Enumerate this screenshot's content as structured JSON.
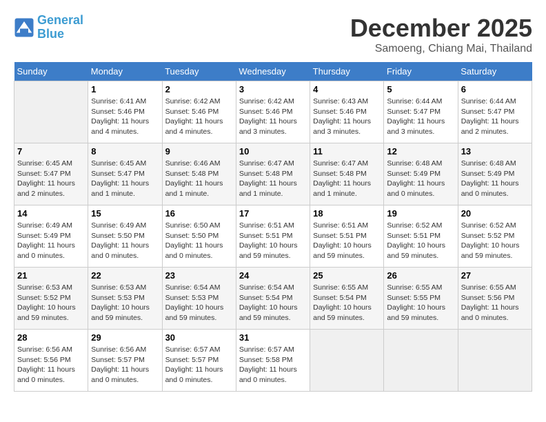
{
  "header": {
    "logo_line1": "General",
    "logo_line2": "Blue",
    "month": "December 2025",
    "location": "Samoeng, Chiang Mai, Thailand"
  },
  "days_of_week": [
    "Sunday",
    "Monday",
    "Tuesday",
    "Wednesday",
    "Thursday",
    "Friday",
    "Saturday"
  ],
  "weeks": [
    [
      {
        "day": "",
        "empty": true
      },
      {
        "day": "1",
        "sunrise": "Sunrise: 6:41 AM",
        "sunset": "Sunset: 5:46 PM",
        "daylight": "Daylight: 11 hours and 4 minutes."
      },
      {
        "day": "2",
        "sunrise": "Sunrise: 6:42 AM",
        "sunset": "Sunset: 5:46 PM",
        "daylight": "Daylight: 11 hours and 4 minutes."
      },
      {
        "day": "3",
        "sunrise": "Sunrise: 6:42 AM",
        "sunset": "Sunset: 5:46 PM",
        "daylight": "Daylight: 11 hours and 3 minutes."
      },
      {
        "day": "4",
        "sunrise": "Sunrise: 6:43 AM",
        "sunset": "Sunset: 5:46 PM",
        "daylight": "Daylight: 11 hours and 3 minutes."
      },
      {
        "day": "5",
        "sunrise": "Sunrise: 6:44 AM",
        "sunset": "Sunset: 5:47 PM",
        "daylight": "Daylight: 11 hours and 3 minutes."
      },
      {
        "day": "6",
        "sunrise": "Sunrise: 6:44 AM",
        "sunset": "Sunset: 5:47 PM",
        "daylight": "Daylight: 11 hours and 2 minutes."
      }
    ],
    [
      {
        "day": "7",
        "sunrise": "Sunrise: 6:45 AM",
        "sunset": "Sunset: 5:47 PM",
        "daylight": "Daylight: 11 hours and 2 minutes."
      },
      {
        "day": "8",
        "sunrise": "Sunrise: 6:45 AM",
        "sunset": "Sunset: 5:47 PM",
        "daylight": "Daylight: 11 hours and 1 minute."
      },
      {
        "day": "9",
        "sunrise": "Sunrise: 6:46 AM",
        "sunset": "Sunset: 5:48 PM",
        "daylight": "Daylight: 11 hours and 1 minute."
      },
      {
        "day": "10",
        "sunrise": "Sunrise: 6:47 AM",
        "sunset": "Sunset: 5:48 PM",
        "daylight": "Daylight: 11 hours and 1 minute."
      },
      {
        "day": "11",
        "sunrise": "Sunrise: 6:47 AM",
        "sunset": "Sunset: 5:48 PM",
        "daylight": "Daylight: 11 hours and 1 minute."
      },
      {
        "day": "12",
        "sunrise": "Sunrise: 6:48 AM",
        "sunset": "Sunset: 5:49 PM",
        "daylight": "Daylight: 11 hours and 0 minutes."
      },
      {
        "day": "13",
        "sunrise": "Sunrise: 6:48 AM",
        "sunset": "Sunset: 5:49 PM",
        "daylight": "Daylight: 11 hours and 0 minutes."
      }
    ],
    [
      {
        "day": "14",
        "sunrise": "Sunrise: 6:49 AM",
        "sunset": "Sunset: 5:49 PM",
        "daylight": "Daylight: 11 hours and 0 minutes."
      },
      {
        "day": "15",
        "sunrise": "Sunrise: 6:49 AM",
        "sunset": "Sunset: 5:50 PM",
        "daylight": "Daylight: 11 hours and 0 minutes."
      },
      {
        "day": "16",
        "sunrise": "Sunrise: 6:50 AM",
        "sunset": "Sunset: 5:50 PM",
        "daylight": "Daylight: 11 hours and 0 minutes."
      },
      {
        "day": "17",
        "sunrise": "Sunrise: 6:51 AM",
        "sunset": "Sunset: 5:51 PM",
        "daylight": "Daylight: 10 hours and 59 minutes."
      },
      {
        "day": "18",
        "sunrise": "Sunrise: 6:51 AM",
        "sunset": "Sunset: 5:51 PM",
        "daylight": "Daylight: 10 hours and 59 minutes."
      },
      {
        "day": "19",
        "sunrise": "Sunrise: 6:52 AM",
        "sunset": "Sunset: 5:51 PM",
        "daylight": "Daylight: 10 hours and 59 minutes."
      },
      {
        "day": "20",
        "sunrise": "Sunrise: 6:52 AM",
        "sunset": "Sunset: 5:52 PM",
        "daylight": "Daylight: 10 hours and 59 minutes."
      }
    ],
    [
      {
        "day": "21",
        "sunrise": "Sunrise: 6:53 AM",
        "sunset": "Sunset: 5:52 PM",
        "daylight": "Daylight: 10 hours and 59 minutes."
      },
      {
        "day": "22",
        "sunrise": "Sunrise: 6:53 AM",
        "sunset": "Sunset: 5:53 PM",
        "daylight": "Daylight: 10 hours and 59 minutes."
      },
      {
        "day": "23",
        "sunrise": "Sunrise: 6:54 AM",
        "sunset": "Sunset: 5:53 PM",
        "daylight": "Daylight: 10 hours and 59 minutes."
      },
      {
        "day": "24",
        "sunrise": "Sunrise: 6:54 AM",
        "sunset": "Sunset: 5:54 PM",
        "daylight": "Daylight: 10 hours and 59 minutes."
      },
      {
        "day": "25",
        "sunrise": "Sunrise: 6:55 AM",
        "sunset": "Sunset: 5:54 PM",
        "daylight": "Daylight: 10 hours and 59 minutes."
      },
      {
        "day": "26",
        "sunrise": "Sunrise: 6:55 AM",
        "sunset": "Sunset: 5:55 PM",
        "daylight": "Daylight: 10 hours and 59 minutes."
      },
      {
        "day": "27",
        "sunrise": "Sunrise: 6:55 AM",
        "sunset": "Sunset: 5:56 PM",
        "daylight": "Daylight: 11 hours and 0 minutes."
      }
    ],
    [
      {
        "day": "28",
        "sunrise": "Sunrise: 6:56 AM",
        "sunset": "Sunset: 5:56 PM",
        "daylight": "Daylight: 11 hours and 0 minutes."
      },
      {
        "day": "29",
        "sunrise": "Sunrise: 6:56 AM",
        "sunset": "Sunset: 5:57 PM",
        "daylight": "Daylight: 11 hours and 0 minutes."
      },
      {
        "day": "30",
        "sunrise": "Sunrise: 6:57 AM",
        "sunset": "Sunset: 5:57 PM",
        "daylight": "Daylight: 11 hours and 0 minutes."
      },
      {
        "day": "31",
        "sunrise": "Sunrise: 6:57 AM",
        "sunset": "Sunset: 5:58 PM",
        "daylight": "Daylight: 11 hours and 0 minutes."
      },
      {
        "day": "",
        "empty": true
      },
      {
        "day": "",
        "empty": true
      },
      {
        "day": "",
        "empty": true
      }
    ]
  ]
}
